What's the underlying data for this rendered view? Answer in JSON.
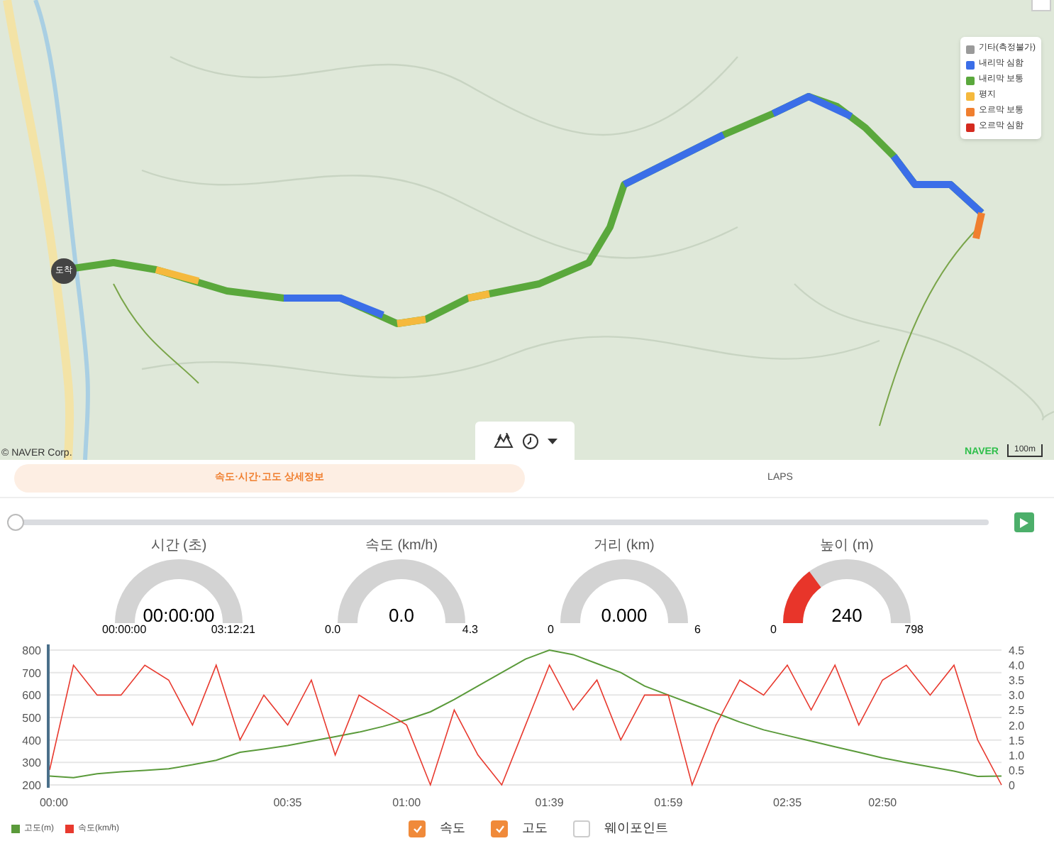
{
  "map": {
    "legend": [
      {
        "label": "기타(측정불가)",
        "color": "#9a9a9a"
      },
      {
        "label": "내리막 심함",
        "color": "#3b6ee8"
      },
      {
        "label": "내리막 보통",
        "color": "#5aa83c"
      },
      {
        "label": "평지",
        "color": "#f5b93d"
      },
      {
        "label": "오르막 보통",
        "color": "#f07f2f"
      },
      {
        "label": "오르막 심함",
        "color": "#d42a1f"
      }
    ],
    "marker": "도착",
    "copyright": "© NAVER Corp.",
    "logo": "NAVER",
    "scale": "100m"
  },
  "tabs": [
    {
      "label": "속도·시간·고도 상세정보",
      "selected": true
    },
    {
      "label": "LAPS",
      "selected": false
    }
  ],
  "playback": {
    "level": 0
  },
  "gauges": [
    {
      "label": "시간 (초)",
      "value": "00:00:00",
      "min": "00:00:00",
      "max": "03:12:21"
    },
    {
      "label": "속도 (km/h)",
      "value": "0.0",
      "min": "0.0",
      "max": "4.3"
    },
    {
      "label": "거리 (km)",
      "value": "0.000",
      "min": "0",
      "max": "6"
    },
    {
      "label": "높이 (m)",
      "value": "240",
      "min": "0",
      "max": "798",
      "level": 0.3
    }
  ],
  "chart": {
    "chart_data": {
      "type": "line",
      "grid": true,
      "categories": [
        "00:00",
        null,
        null,
        null,
        null,
        null,
        null,
        null,
        null,
        null,
        "00:35",
        null,
        null,
        null,
        null,
        "01:00",
        null,
        null,
        null,
        null,
        null,
        "01:39",
        null,
        null,
        null,
        null,
        "01:59",
        null,
        null,
        null,
        null,
        "02:35",
        null,
        null,
        null,
        "02:50",
        null,
        null,
        null,
        null,
        null
      ],
      "ylim": [
        200,
        800
      ],
      "yticks": [
        200,
        300,
        400,
        500,
        600,
        700,
        800
      ],
      "y2lim": [
        0,
        4.5
      ],
      "y2ticks": [
        {
          "value": 0,
          "label": "0"
        },
        {
          "value": 0.5,
          "label": "0.5"
        },
        {
          "value": 1,
          "label": "1.0"
        },
        {
          "value": 1.5,
          "label": "1.5"
        },
        {
          "value": 2,
          "label": "2.0"
        },
        {
          "value": 2.5,
          "label": "2.5"
        },
        {
          "value": 3,
          "label": "3.0"
        },
        {
          "value": 3.5,
          "label": "3.5"
        },
        {
          "value": 4,
          "label": "4.0"
        },
        {
          "value": 4.5,
          "label": "4.5"
        }
      ],
      "series": [
        {
          "name": "고도(m)",
          "color": "#5a9a3a",
          "values": [
            240,
            232,
            250,
            258,
            265,
            272,
            290,
            310,
            345,
            360,
            375,
            395,
            415,
            435,
            460,
            490,
            525,
            580,
            640,
            700,
            760,
            800,
            780,
            740,
            700,
            640,
            600,
            560,
            520,
            480,
            445,
            420,
            395,
            370,
            345,
            320,
            300,
            280,
            262,
            238,
            240
          ]
        },
        {
          "name": "속도(km/h)",
          "color": "#e8392e",
          "axis": "y2",
          "values": [
            0.5,
            4,
            3,
            3,
            4,
            3.5,
            2,
            4,
            1.5,
            3,
            2,
            3.5,
            1,
            3,
            2.5,
            2,
            0,
            2.5,
            1,
            0,
            2,
            4,
            2.5,
            3.5,
            1.5,
            3,
            3,
            0,
            2,
            3.5,
            3,
            4,
            2.5,
            4,
            2,
            3.5,
            4,
            3,
            4,
            1.5,
            0
          ]
        }
      ]
    }
  },
  "toggles": [
    {
      "label": "속도",
      "checked": true
    },
    {
      "label": "고도",
      "checked": true
    },
    {
      "label": "웨이포인트",
      "checked": false
    }
  ]
}
